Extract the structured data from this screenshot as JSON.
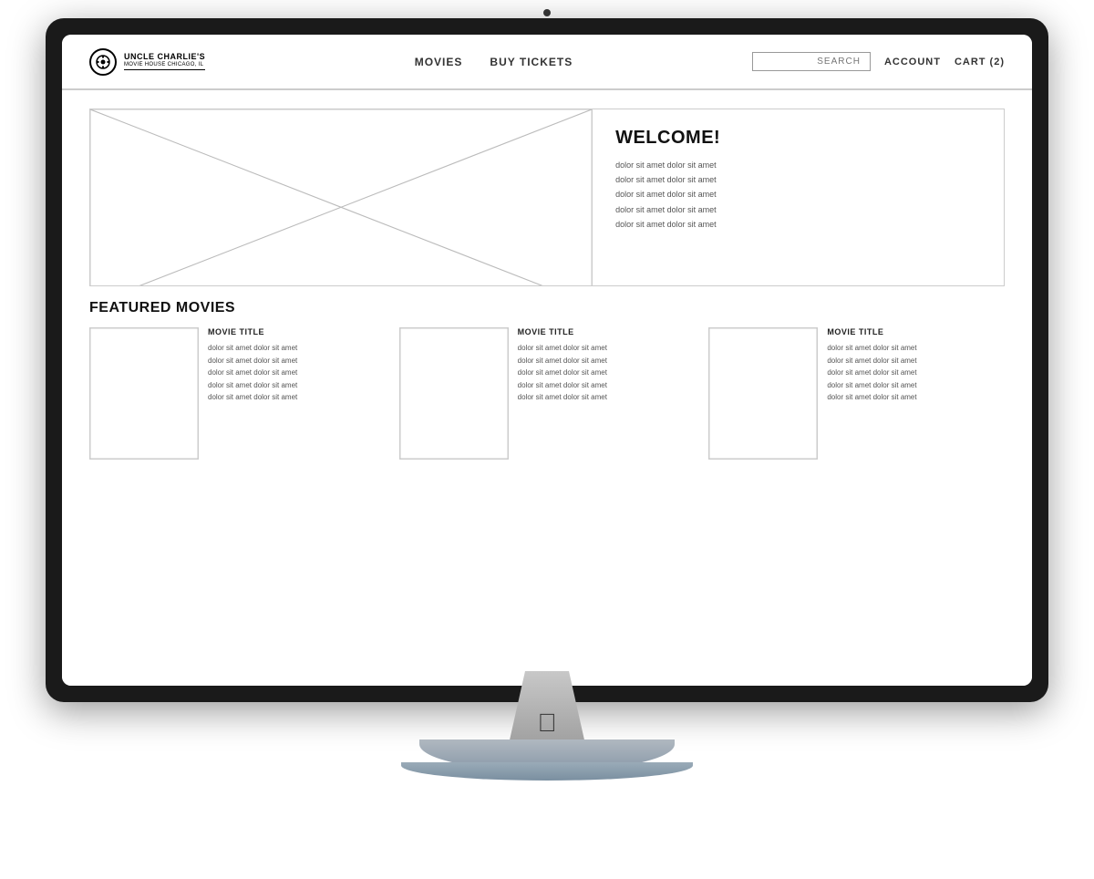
{
  "monitor": {
    "camera_label": "camera"
  },
  "nav": {
    "logo_title": "UNCLE CHARLIE'S",
    "logo_subtitle": "MOVIE HOUSE CHICAGO, IL",
    "movies_label": "MOVIES",
    "buy_tickets_label": "BUY TICKETS",
    "search_placeholder": "SEARCH",
    "account_label": "ACCOUNT",
    "cart_label": "CART (2)"
  },
  "hero": {
    "title": "WELCOME!",
    "body_line1": "dolor sit amet dolor sit amet",
    "body_line2": "dolor sit amet dolor sit amet",
    "body_line3": "dolor sit amet dolor sit amet",
    "body_line4": "dolor sit amet dolor sit amet",
    "body_line5": "dolor sit amet dolor sit amet"
  },
  "featured": {
    "section_title": "FEATURED MOVIES",
    "movies": [
      {
        "title": "MOVIE TITLE",
        "desc_line1": "dolor sit amet dolor sit amet",
        "desc_line2": "dolor sit amet dolor sit amet",
        "desc_line3": "dolor sit amet dolor sit amet",
        "desc_line4": "dolor sit amet dolor sit amet",
        "desc_line5": "dolor sit amet dolor sit amet"
      },
      {
        "title": "MOVIE TITLE",
        "desc_line1": "dolor sit amet dolor sit amet",
        "desc_line2": "dolor sit amet dolor sit amet",
        "desc_line3": "dolor sit amet dolor sit amet",
        "desc_line4": "dolor sit amet dolor sit amet",
        "desc_line5": "dolor sit amet dolor sit amet"
      },
      {
        "title": "MOVIE TITLE",
        "desc_line1": "dolor sit amet dolor sit amet",
        "desc_line2": "dolor sit amet dolor sit amet",
        "desc_line3": "dolor sit amet dolor sit amet",
        "desc_line4": "dolor sit amet dolor sit amet",
        "desc_line5": "dolor sit amet dolor sit amet"
      }
    ]
  }
}
